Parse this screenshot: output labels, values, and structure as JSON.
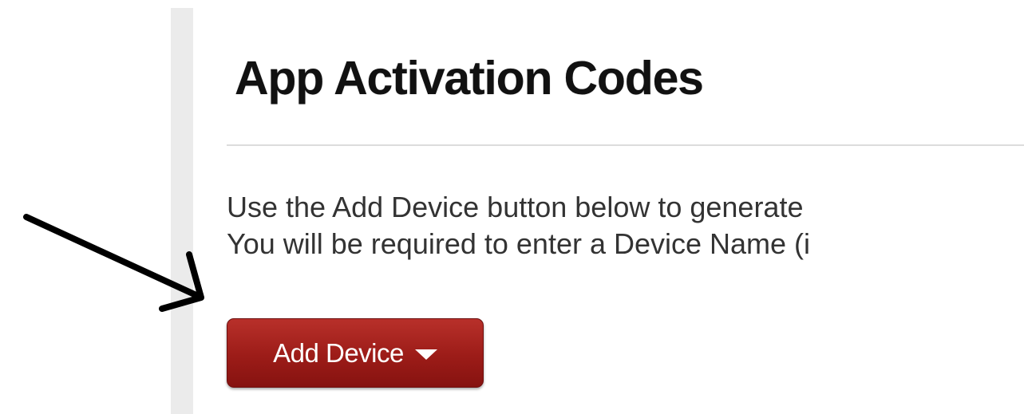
{
  "page": {
    "title": "App Activation Codes",
    "instructions": [
      "Use the Add Device button below to generate",
      "You will be required to enter a Device Name (i"
    ]
  },
  "toolbar": {
    "add_device_label": "Add Device",
    "add_device_icon": "caret-down-icon"
  },
  "annotation": {
    "icon": "arrow-icon",
    "color": "#000000"
  },
  "colors": {
    "button_accent": "#9c1c18",
    "title_text": "#111111",
    "body_text": "#333333",
    "sidebar": "#ebebeb"
  }
}
